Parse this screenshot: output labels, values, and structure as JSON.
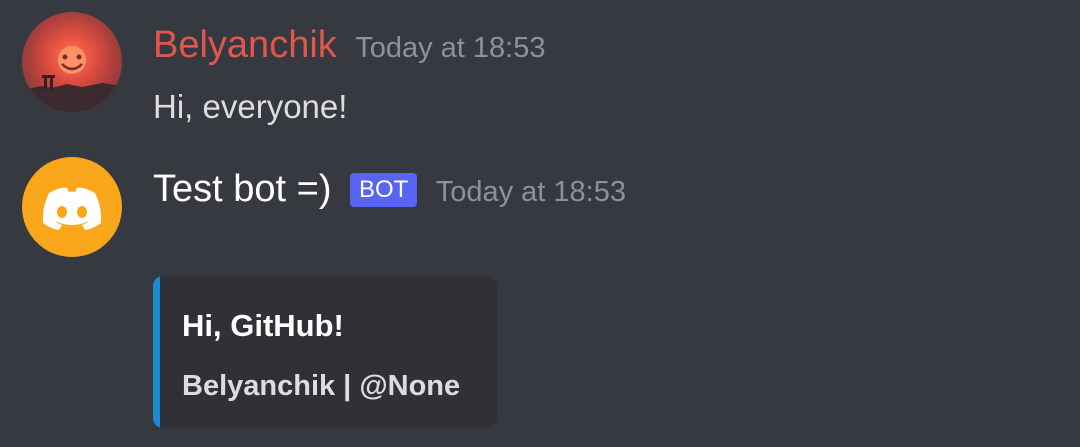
{
  "colors": {
    "background": "#36393f",
    "username_red": "#e0584b",
    "bot_tag": "#5865f2",
    "bot_avatar": "#faa61a",
    "embed_background": "#2f3136",
    "embed_accent": "#1a8ad3",
    "timestamp": "#8e9297"
  },
  "messages": [
    {
      "avatar_icon": "sunset-photo-avatar",
      "username": "Belyanchik",
      "timestamp": "Today at 18:53",
      "content": "Hi, everyone!"
    },
    {
      "avatar_icon": "discord-logo-icon",
      "username": "Test bot =)",
      "bot_tag": "BOT",
      "timestamp": "Today at 18:53",
      "embed": {
        "title": "Hi, GitHub!",
        "description": "Belyanchik | @None"
      }
    }
  ]
}
